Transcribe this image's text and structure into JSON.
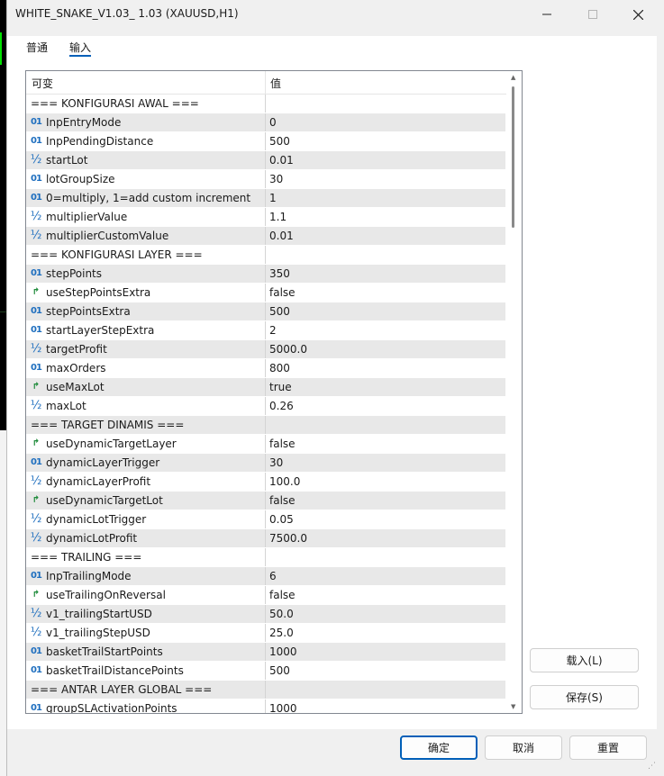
{
  "window": {
    "title": "WHITE_SNAKE_V1.03_ 1.03 (XAUUSD,H1)"
  },
  "tabs": [
    {
      "label": "普通"
    },
    {
      "label": "输入"
    }
  ],
  "grid": {
    "col_variable": "可变",
    "col_value": "值",
    "rows": [
      {
        "type": "section",
        "label": "=== KONFIGURASI AWAL ===",
        "value": ""
      },
      {
        "type": "int",
        "icon": "01",
        "label": "InpEntryMode",
        "value": "0"
      },
      {
        "type": "int",
        "icon": "01",
        "label": "InpPendingDistance",
        "value": "500"
      },
      {
        "type": "double",
        "icon": "½",
        "label": "startLot",
        "value": "0.01"
      },
      {
        "type": "int",
        "icon": "01",
        "label": "lotGroupSize",
        "value": "30"
      },
      {
        "type": "int",
        "icon": "01",
        "label": "0=multiply, 1=add custom increment",
        "value": "1"
      },
      {
        "type": "double",
        "icon": "½",
        "label": "multiplierValue",
        "value": "1.1"
      },
      {
        "type": "double",
        "icon": "½",
        "label": "multiplierCustomValue",
        "value": "0.01"
      },
      {
        "type": "section",
        "label": "=== KONFIGURASI LAYER ===",
        "value": ""
      },
      {
        "type": "int",
        "icon": "01",
        "label": "stepPoints",
        "value": "350"
      },
      {
        "type": "bool",
        "icon": "↱",
        "label": "useStepPointsExtra",
        "value": "false"
      },
      {
        "type": "int",
        "icon": "01",
        "label": "stepPointsExtra",
        "value": "500"
      },
      {
        "type": "int",
        "icon": "01",
        "label": "startLayerStepExtra",
        "value": "2"
      },
      {
        "type": "double",
        "icon": "½",
        "label": "targetProfit",
        "value": "5000.0"
      },
      {
        "type": "int",
        "icon": "01",
        "label": "maxOrders",
        "value": "800"
      },
      {
        "type": "bool",
        "icon": "↱",
        "label": "useMaxLot",
        "value": "true"
      },
      {
        "type": "double",
        "icon": "½",
        "label": "maxLot",
        "value": "0.26"
      },
      {
        "type": "section",
        "label": "=== TARGET DINAMIS ===",
        "value": ""
      },
      {
        "type": "bool",
        "icon": "↱",
        "label": "useDynamicTargetLayer",
        "value": "false"
      },
      {
        "type": "int",
        "icon": "01",
        "label": "dynamicLayerTrigger",
        "value": "30"
      },
      {
        "type": "double",
        "icon": "½",
        "label": "dynamicLayerProfit",
        "value": "100.0"
      },
      {
        "type": "bool",
        "icon": "↱",
        "label": "useDynamicTargetLot",
        "value": "false"
      },
      {
        "type": "double",
        "icon": "½",
        "label": "dynamicLotTrigger",
        "value": "0.05"
      },
      {
        "type": "double",
        "icon": "½",
        "label": "dynamicLotProfit",
        "value": "7500.0"
      },
      {
        "type": "section",
        "label": "=== TRAILING ===",
        "value": ""
      },
      {
        "type": "int",
        "icon": "01",
        "label": "InpTrailingMode",
        "value": "6"
      },
      {
        "type": "bool",
        "icon": "↱",
        "label": "useTrailingOnReversal",
        "value": "false"
      },
      {
        "type": "double",
        "icon": "½",
        "label": "v1_trailingStartUSD",
        "value": "50.0"
      },
      {
        "type": "double",
        "icon": "½",
        "label": "v1_trailingStepUSD",
        "value": "25.0"
      },
      {
        "type": "int",
        "icon": "01",
        "label": "basketTrailStartPoints",
        "value": "1000"
      },
      {
        "type": "int",
        "icon": "01",
        "label": "basketTrailDistancePoints",
        "value": "500"
      },
      {
        "type": "section",
        "label": "=== ANTAR LAYER GLOBAL ===",
        "value": ""
      },
      {
        "type": "int",
        "icon": "01",
        "label": "groupSLActivationPoints",
        "value": "1000"
      }
    ]
  },
  "buttons": {
    "load": "载入(L)",
    "save": "保存(S)",
    "ok": "确定",
    "cancel": "取消",
    "reset": "重置"
  },
  "colors": {
    "accent": "#005fb8",
    "int_icon": "#1f6fbf",
    "bool_icon": "#1e8b3a",
    "alt_row": "#e8e8e8"
  }
}
